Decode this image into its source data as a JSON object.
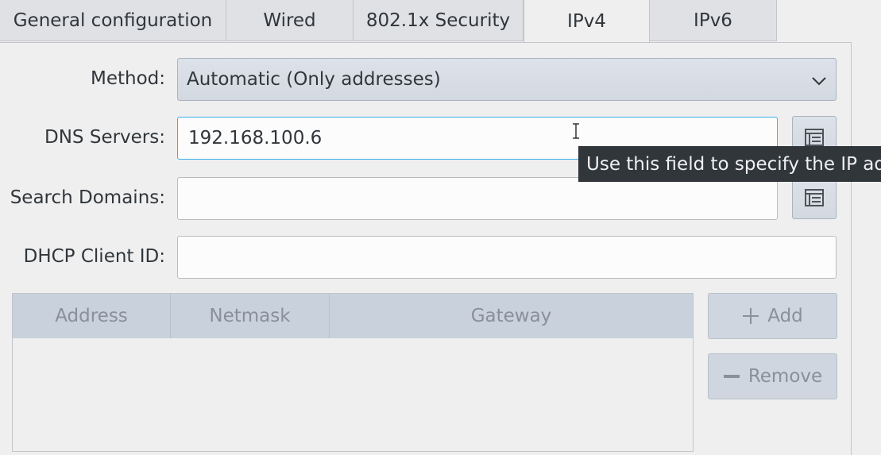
{
  "tabs": [
    {
      "label": "General configuration",
      "active": false
    },
    {
      "label": "Wired",
      "active": false
    },
    {
      "label": "802.1x Security",
      "active": false
    },
    {
      "label": "IPv4",
      "active": true
    },
    {
      "label": "IPv6",
      "active": false
    }
  ],
  "method": {
    "label": "Method:",
    "value": "Automatic (Only addresses)"
  },
  "dns": {
    "label": "DNS Servers:",
    "value": "192.168.100.6"
  },
  "search_domains": {
    "label": "Search Domains:",
    "value": ""
  },
  "dhcp_client_id": {
    "label": "DHCP Client ID:",
    "value": ""
  },
  "tooltip": {
    "text": "Use this field to specify the IP ad"
  },
  "table": {
    "columns": [
      "Address",
      "Netmask",
      "Gateway"
    ],
    "rows": []
  },
  "buttons": {
    "add": "Add",
    "remove": "Remove"
  },
  "colors": {
    "focus": "#3daee9",
    "tooltip_bg": "#31363b"
  },
  "icons": {
    "list_edit": "list-edit-icon",
    "chevron": "chevron-down-icon",
    "add": "plus-icon",
    "remove": "minus-icon",
    "cursor": "text-cursor-icon"
  }
}
